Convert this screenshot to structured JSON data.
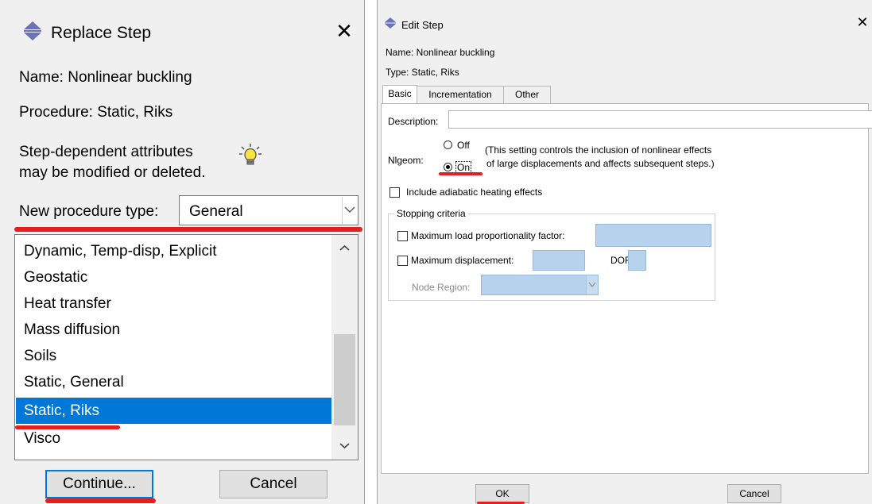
{
  "replace_step": {
    "title": "Replace Step",
    "close_glyph": "✕",
    "name_text": "Name:  Nonlinear buckling",
    "procedure_text": "Procedure:  Static, Riks",
    "note_line1": "Step-dependent attributes",
    "note_line2": "may be modified or deleted.",
    "new_procedure_label": "New procedure type:",
    "new_procedure_value": "General",
    "list_items": [
      "Dynamic, Temp-disp, Explicit",
      "Geostatic",
      "Heat transfer",
      "Mass diffusion",
      "Soils",
      "Static, General",
      "Static, Riks",
      "Visco"
    ],
    "selected_item": "Static, Riks",
    "continue_label": "Continue...",
    "cancel_label": "Cancel"
  },
  "edit_step": {
    "title": "Edit Step",
    "close_glyph": "✕",
    "name_text": "Name:  Nonlinear buckling",
    "type_text": "Type:  Static, Riks",
    "tabs": [
      "Basic",
      "Incrementation",
      "Other"
    ],
    "active_tab": "Basic",
    "description_label": "Description:",
    "description_value": "",
    "nlgeom_label": "Nlgeom:",
    "nlgeom_off": "Off",
    "nlgeom_on": "On",
    "nlgeom_selected": "On",
    "nlgeom_note_line1": "(This setting controls the inclusion of nonlinear effects",
    "nlgeom_note_line2": "of large displacements and affects subsequent steps.)",
    "adiabatic_label": "Include adiabatic heating effects",
    "stopping_criteria_label": "Stopping criteria",
    "max_lpf_label": "Maximum load proportionality factor:",
    "max_disp_label": "Maximum displacement:",
    "dof_label": "DOF:",
    "node_region_label": "Node Region:",
    "ok_label": "OK",
    "cancel_label": "Cancel"
  },
  "colors": {
    "selection": "#0078d7",
    "annotation_red": "#e41f1f",
    "field_blue": "#b7d2ec"
  },
  "icons": [
    "step-arrows-icon",
    "lightbulb-icon",
    "close-icon",
    "chevron-down-icon",
    "chevron-up-icon"
  ]
}
